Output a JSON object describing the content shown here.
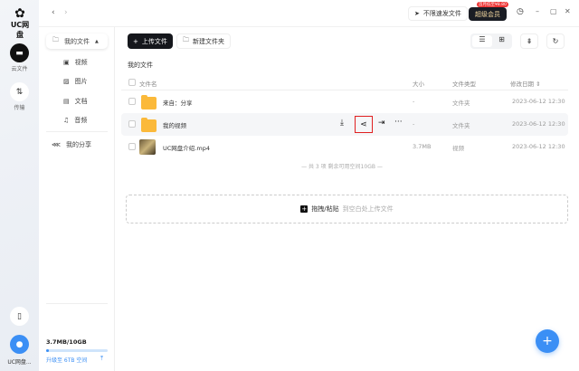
{
  "app": {
    "logo": "UC网盘"
  },
  "rail": {
    "items": [
      {
        "label": "云文件",
        "icon": "folder-icon"
      },
      {
        "label": "传输",
        "icon": "transfer-icon"
      }
    ],
    "user": "UC网盘..."
  },
  "topbar": {
    "fast_send": "不限速发文件",
    "vip_badge": "首月低至¥8.80",
    "vip": "超级会员"
  },
  "sidebar": {
    "my_files": "我的文件",
    "items": [
      {
        "label": "视频"
      },
      {
        "label": "图片"
      },
      {
        "label": "文档"
      },
      {
        "label": "音频"
      }
    ],
    "my_share": "我的分享",
    "storage": "3.7MB/10GB",
    "storage_used_pct": 0.04,
    "upgrade": "升级至 6TB 空间"
  },
  "toolbar": {
    "upload": "上传文件",
    "new_folder": "新建文件夹"
  },
  "main": {
    "title": "我的文件",
    "columns": {
      "name": "文件名",
      "size": "大小",
      "type": "文件类型",
      "date": "修改日期"
    },
    "rows": [
      {
        "name": "来自：分享",
        "size": "-",
        "type": "文件夹",
        "date": "2023-06-12 12:30",
        "kind": "folder"
      },
      {
        "name": "我的视频",
        "size": "-",
        "type": "文件夹",
        "date": "2023-06-12 12:30",
        "kind": "folder"
      },
      {
        "name": "UC网盘介绍.mp4",
        "size": "3.7MB",
        "type": "视频",
        "date": "2023-06-12 12:30",
        "kind": "video"
      }
    ],
    "summary": "— 共 3 项 剩余可用空间10GB —",
    "drop_strong": "拖拽/粘贴",
    "drop_hint": "到空白处上传文件"
  },
  "colors": {
    "accent": "#3b8ff5",
    "highlight": "#e02020",
    "folder": "#fbb93a"
  }
}
